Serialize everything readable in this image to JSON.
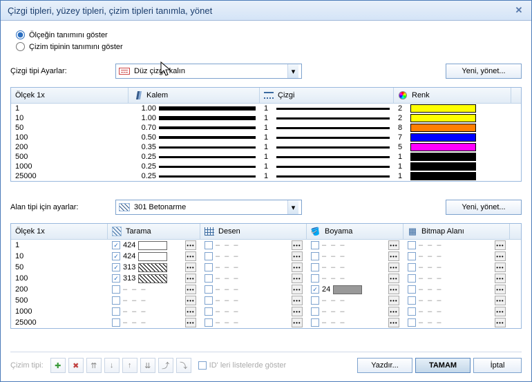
{
  "title": "Çizgi tipleri, yüzey tipleri, çizim tipleri tanımla, yönet",
  "radio": {
    "scale": "Ölçeğin tanımını göster",
    "style": "Çizim tipinin tanımını göster",
    "selected": "scale"
  },
  "lineStyle": {
    "label": "Çizgi tipi Ayarlar:",
    "value": "Düz çizgi, kalın",
    "newManage": "Yeni, yönet..."
  },
  "table1": {
    "headers": {
      "scale": "Ölçek 1x",
      "pen": "Kalem",
      "line": "Çizgi",
      "color": "Renk"
    },
    "rows": [
      {
        "scale": "1",
        "pen": "1.00",
        "thick": "thick",
        "line": "1",
        "color": "2",
        "swatch": "#ffff00"
      },
      {
        "scale": "10",
        "pen": "1.00",
        "thick": "thick",
        "line": "1",
        "color": "2",
        "swatch": "#ffff00"
      },
      {
        "scale": "50",
        "pen": "0.70",
        "thick": "med",
        "line": "1",
        "color": "8",
        "swatch": "#ff7f00"
      },
      {
        "scale": "100",
        "pen": "0.50",
        "thick": "med",
        "line": "1",
        "color": "7",
        "swatch": "#0000ff"
      },
      {
        "scale": "200",
        "pen": "0.35",
        "thick": "thin",
        "line": "1",
        "color": "5",
        "swatch": "#ff00ff"
      },
      {
        "scale": "500",
        "pen": "0.25",
        "thick": "thin",
        "line": "1",
        "color": "1",
        "swatch": "#000000"
      },
      {
        "scale": "1000",
        "pen": "0.25",
        "thick": "thin",
        "line": "1",
        "color": "1",
        "swatch": "#000000"
      },
      {
        "scale": "25000",
        "pen": "0.25",
        "thick": "thin",
        "line": "1",
        "color": "1",
        "swatch": "#000000"
      }
    ]
  },
  "areaStyle": {
    "label": "Alan tipi için ayarlar:",
    "value": "301 Betonarme",
    "newManage": "Yeni, yönet..."
  },
  "table2": {
    "headers": {
      "scale": "Ölçek 1x",
      "hatch": "Tarama",
      "pattern": "Desen",
      "fill": "Boyama",
      "bitmap": "Bitmap Alanı"
    },
    "rows": [
      {
        "scale": "1",
        "hChk": true,
        "hVal": "424",
        "hSw": "white",
        "pChk": false,
        "pVal": "---",
        "fChk": false,
        "fVal": "---",
        "fSw": "",
        "bChk": false,
        "bVal": "---"
      },
      {
        "scale": "10",
        "hChk": true,
        "hVal": "424",
        "hSw": "white",
        "pChk": false,
        "pVal": "---",
        "fChk": false,
        "fVal": "---",
        "fSw": "",
        "bChk": false,
        "bVal": "---"
      },
      {
        "scale": "50",
        "hChk": true,
        "hVal": "313",
        "hSw": "diag",
        "pChk": false,
        "pVal": "---",
        "fChk": false,
        "fVal": "---",
        "fSw": "",
        "bChk": false,
        "bVal": "---"
      },
      {
        "scale": "100",
        "hChk": true,
        "hVal": "313",
        "hSw": "diag",
        "pChk": false,
        "pVal": "---",
        "fChk": false,
        "fVal": "---",
        "fSw": "",
        "bChk": false,
        "bVal": "---"
      },
      {
        "scale": "200",
        "hChk": false,
        "hVal": "---",
        "hSw": "",
        "pChk": false,
        "pVal": "---",
        "fChk": true,
        "fVal": "24",
        "fSw": "gray",
        "bChk": false,
        "bVal": "---"
      },
      {
        "scale": "500",
        "hChk": false,
        "hVal": "---",
        "hSw": "",
        "pChk": false,
        "pVal": "---",
        "fChk": false,
        "fVal": "---",
        "fSw": "",
        "bChk": false,
        "bVal": "---"
      },
      {
        "scale": "1000",
        "hChk": false,
        "hVal": "---",
        "hSw": "",
        "pChk": false,
        "pVal": "---",
        "fChk": false,
        "fVal": "---",
        "fSw": "",
        "bChk": false,
        "bVal": "---"
      },
      {
        "scale": "25000",
        "hChk": false,
        "hVal": "---",
        "hSw": "",
        "pChk": false,
        "pVal": "---",
        "fChk": false,
        "fVal": "---",
        "fSw": "",
        "bChk": false,
        "bVal": "---"
      }
    ]
  },
  "footer": {
    "label": "Çizim tipi:",
    "showIds": "ID' leri listelerde göster",
    "print": "Yazdır...",
    "ok": "TAMAM",
    "cancel": "İptal"
  },
  "icons": {
    "add": "✚",
    "del": "✖",
    "top": "⇈",
    "up": "↑",
    "down": "↓",
    "bottom": "⇊",
    "out": "⤴",
    "in": "⤵"
  }
}
